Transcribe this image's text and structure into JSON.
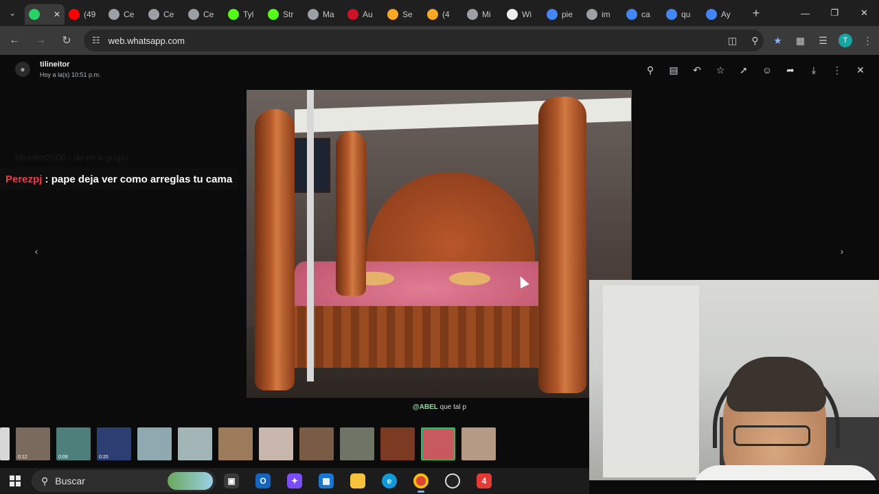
{
  "browser": {
    "tabs": [
      {
        "label": "",
        "icon": "whatsapp-icon",
        "color": "#25d366",
        "active": true
      },
      {
        "label": "(49",
        "icon": "youtube-icon",
        "color": "#ff0000"
      },
      {
        "label": "Ce",
        "icon": "globe-icon",
        "color": "#9aa0a6"
      },
      {
        "label": "Ce",
        "icon": "globe-icon",
        "color": "#9aa0a6"
      },
      {
        "label": "Ce",
        "icon": "globe-icon",
        "color": "#9aa0a6"
      },
      {
        "label": "Tyl",
        "icon": "kick-icon",
        "color": "#53fc18"
      },
      {
        "label": "Str",
        "icon": "kick-icon",
        "color": "#53fc18"
      },
      {
        "label": "Ma",
        "icon": "globe-icon",
        "color": "#9aa0a6"
      },
      {
        "label": "Au",
        "icon": "flag-icon",
        "color": "#ce1126"
      },
      {
        "label": "Se",
        "icon": "orange-app-icon",
        "color": "#f9a825"
      },
      {
        "label": "(4",
        "icon": "orange-app-icon",
        "color": "#f9a825"
      },
      {
        "label": "Mi",
        "icon": "globe-icon",
        "color": "#9aa0a6"
      },
      {
        "label": "Wi",
        "icon": "wiki-icon",
        "color": "#eeeeee"
      },
      {
        "label": "pie",
        "icon": "google-icon",
        "color": "#4285f4"
      },
      {
        "label": "im",
        "icon": "globe-icon",
        "color": "#9aa0a6"
      },
      {
        "label": "ca",
        "icon": "google-icon",
        "color": "#4285f4"
      },
      {
        "label": "qu",
        "icon": "google-icon",
        "color": "#4285f4"
      },
      {
        "label": "Ay",
        "icon": "google-icon",
        "color": "#4285f4"
      }
    ],
    "url": "web.whatsapp.com",
    "profile_initial": "T"
  },
  "viewer": {
    "sender_name": "tilineitor",
    "sender_time": "Hoy a la(s) 10:51 p.m.",
    "caption_mention": "@ABEL",
    "caption_text": " que tal p",
    "faded_line": "tilineitor2000 - de mi a grupo"
  },
  "stream_chat": {
    "user": "Perezpj",
    "separator": " : ",
    "message": "pape deja ver como arreglas tu cama"
  },
  "thumbnails": [
    {
      "duration": "",
      "color": "#d8d8d8"
    },
    {
      "duration": "0:12",
      "color": "#7a6a5e"
    },
    {
      "duration": "0:09",
      "color": "#4f7f7a"
    },
    {
      "duration": "0:20",
      "color": "#2c3e72"
    },
    {
      "duration": "",
      "color": "#8fa9b0"
    },
    {
      "duration": "",
      "color": "#a3b5b7"
    },
    {
      "duration": "",
      "color": "#9b7b5a"
    },
    {
      "duration": "",
      "color": "#c9b6ad"
    },
    {
      "duration": "",
      "color": "#7a5b45"
    },
    {
      "duration": "",
      "color": "#6f7566"
    },
    {
      "duration": "",
      "color": "#7c3a23"
    },
    {
      "duration": "",
      "color": "#c65a5e"
    },
    {
      "duration": "",
      "color": "#b59a86"
    }
  ],
  "taskbar": {
    "search_label": "Buscar"
  },
  "colors": {
    "accent_green": "#21c063",
    "chat_user": "#ff3349"
  }
}
